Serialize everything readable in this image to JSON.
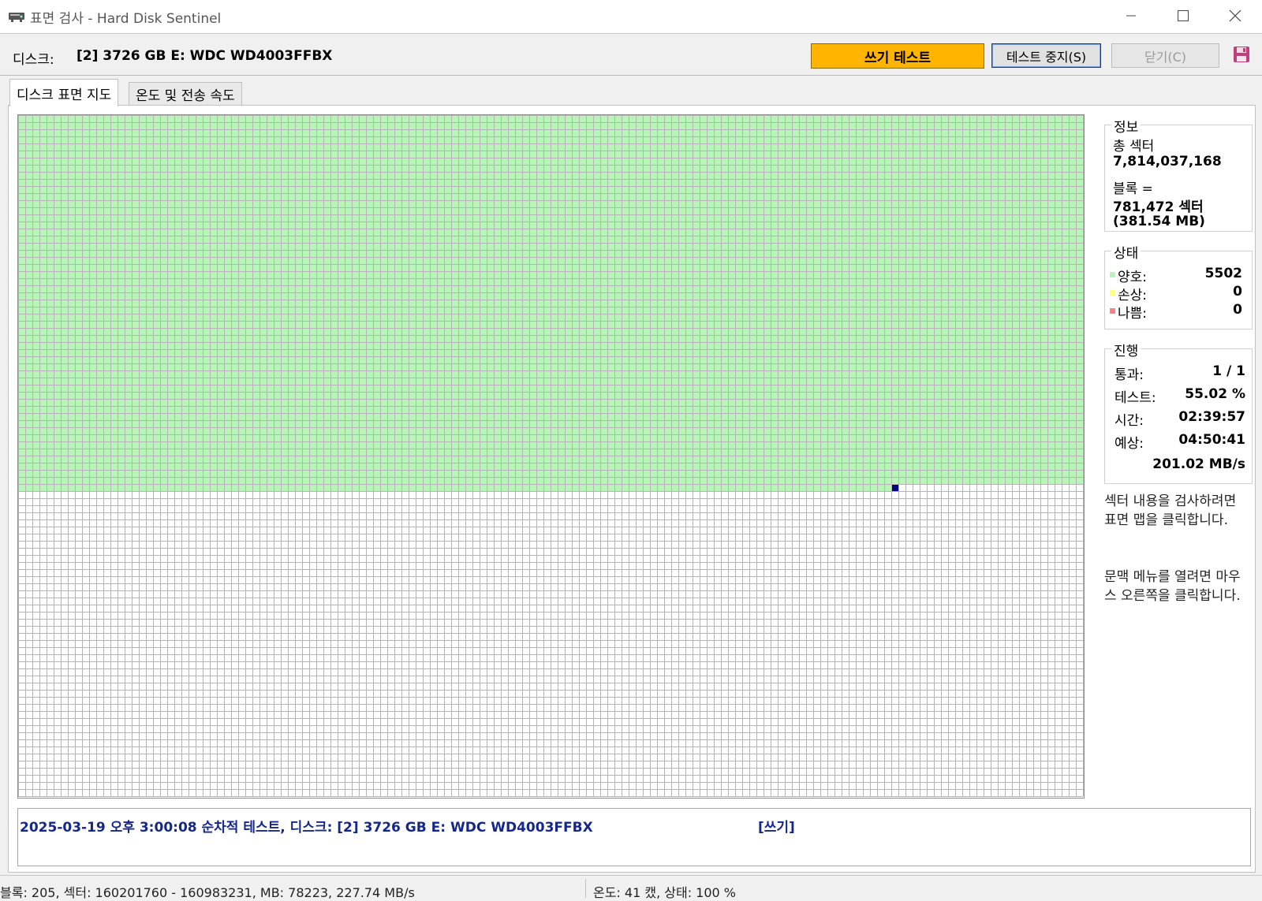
{
  "window": {
    "title": "표면 검사 - Hard Disk Sentinel",
    "icon": "disk-icon",
    "controls": [
      "minimize-icon",
      "maximize-icon",
      "close-icon"
    ]
  },
  "header": {
    "disk_label": "디스크:",
    "disk_name": "[2] 3726 GB E: WDC WD4003FFBX",
    "write_test_label": "쓰기 테스트",
    "stop_test_label": "테스트 중지(S)",
    "close_label": "닫기(C)",
    "save_icon": "save-icon",
    "write_test_color": "#ffb400"
  },
  "tabs": [
    {
      "label": "디스크 표면 지도",
      "active": true
    },
    {
      "label": "온도 및 전송 속도",
      "active": false
    }
  ],
  "surface_map": {
    "colors": {
      "good": "#b9f5b9",
      "untested": "#ffffff",
      "current": "#000080",
      "grid_line": "#b4b4b4"
    },
    "tested_fraction": 0.5502
  },
  "info": {
    "title": "정보",
    "total_sectors_label": "총 섹터",
    "total_sectors_value": "7,814,037,168",
    "block_label": "블록 =",
    "block_sectors": "781,472 섹터",
    "block_size": "(381.54 MB)"
  },
  "status": {
    "title": "상태",
    "good_label": "양호:",
    "good_value": "5502",
    "good_color": "#b9f5b9",
    "damaged_label": "손상:",
    "damaged_value": "0",
    "damaged_color": "#ffff80",
    "bad_label": "나쁨:",
    "bad_value": "0",
    "bad_color": "#ff8080"
  },
  "progress": {
    "title": "진행",
    "pass_label": "통과:",
    "pass_value": "1 / 1",
    "test_label": "테스트:",
    "test_value": "55.02 %",
    "time_label": "시간:",
    "time_value": "02:39:57",
    "estimate_label": "예상:",
    "estimate_value": "04:50:41",
    "speed_value": "201.02 MB/s"
  },
  "notes": {
    "click_map": "섹터 내용을 검사하려면 표면 맵을 클릭합니다.",
    "context_menu": "문맥 메뉴를 열려면 마우스 오른쪽을 클릭합니다."
  },
  "log": {
    "entry": "2025-03-19  오후 3:00:08   순차적 테스트, 디스크: [2] 3726 GB E: WDC WD4003FFBX",
    "tag": "[쓰기]"
  },
  "statusbar": {
    "left": "블록: 205, 섹터: 160201760 - 160983231, MB: 78223, 227.74 MB/s",
    "right": "온도: 41  캤,  상태: 100 %"
  }
}
